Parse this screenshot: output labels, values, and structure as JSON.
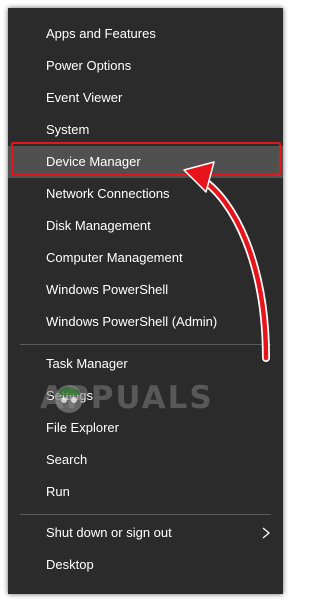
{
  "menu": {
    "items": [
      {
        "label": "Apps and Features"
      },
      {
        "label": "Power Options"
      },
      {
        "label": "Event Viewer"
      },
      {
        "label": "System"
      },
      {
        "label": "Device Manager"
      },
      {
        "label": "Network Connections"
      },
      {
        "label": "Disk Management"
      },
      {
        "label": "Computer Management"
      },
      {
        "label": "Windows PowerShell"
      },
      {
        "label": "Windows PowerShell (Admin)"
      },
      {
        "label": "Task Manager"
      },
      {
        "label": "Settings"
      },
      {
        "label": "File Explorer"
      },
      {
        "label": "Search"
      },
      {
        "label": "Run"
      },
      {
        "label": "Shut down or sign out"
      },
      {
        "label": "Desktop"
      }
    ],
    "highlighted": "Device Manager"
  },
  "watermark": {
    "text": "APPUALS"
  },
  "colors": {
    "menu_bg": "#2b2b2b",
    "highlight_bg": "#505050",
    "annotation_red": "#e8141b",
    "text": "#ffffff"
  },
  "icons": {
    "submenu": "chevron-right-icon",
    "annotation": "curved-arrow-icon"
  }
}
